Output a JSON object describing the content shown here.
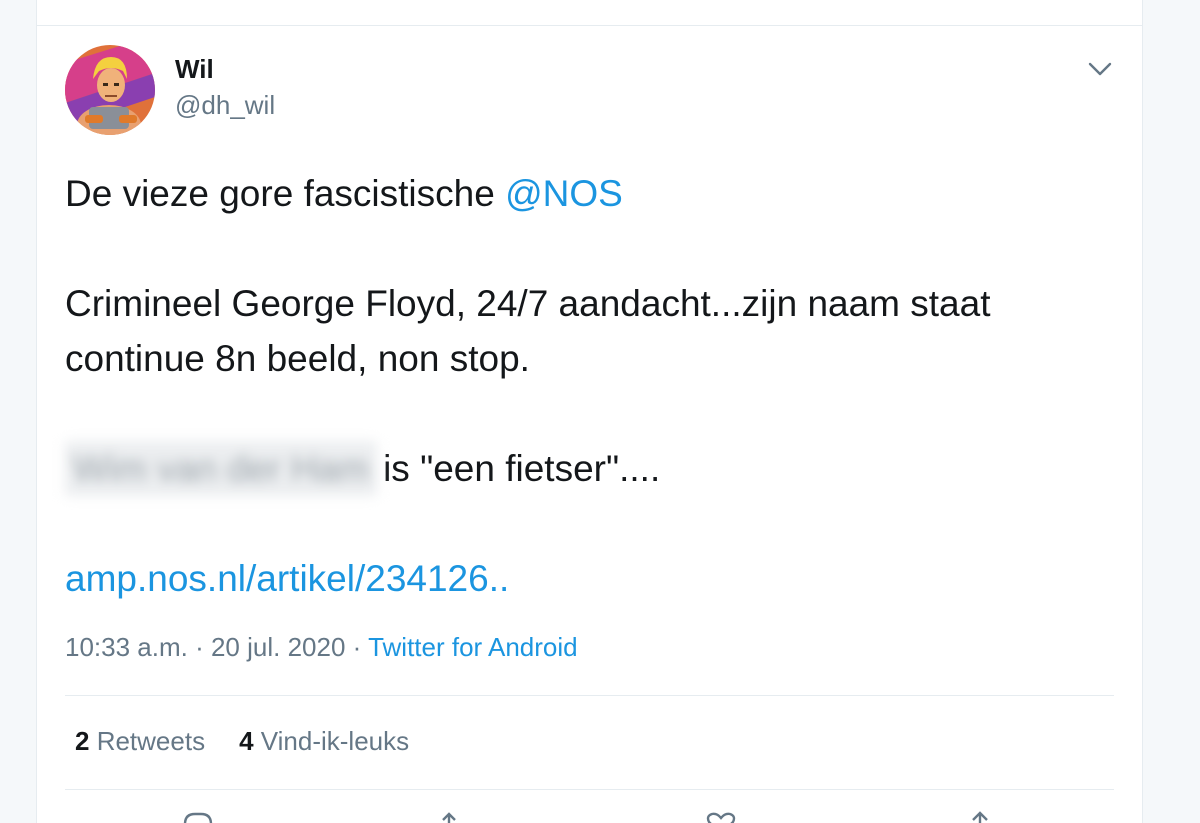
{
  "author": {
    "name": "Wil",
    "handle": "@dh_wil",
    "avatar_icon": "cartoon-hero-avatar"
  },
  "tweet": {
    "line1_text": "De vieze gore fascistische ",
    "line1_mention": "@NOS",
    "paragraph2": "Crimineel George Floyd, 24/7 aandacht...zijn naam staat continue 8n beeld, non stop.",
    "blurred_name": "Wim van der Ham",
    "paragraph3_text": "is \"een fietser\"....",
    "link": "amp.nos.nl/artikel/234126.."
  },
  "meta": {
    "time": "10:33 a.m.",
    "sep1": " · ",
    "date": "20 jul. 2020",
    "sep2": " · ",
    "source": "Twitter for Android"
  },
  "stats": {
    "retweets_count": "2",
    "retweets_label": " Retweets",
    "likes_count": "4",
    "likes_label": " Vind-ik-leuks"
  },
  "icons": {
    "menu": "chevron-down-icon",
    "reply": "reply-icon",
    "retweet": "retweet-icon",
    "like": "heart-icon",
    "share": "share-icon"
  },
  "colors": {
    "link": "#1b95e0",
    "text": "#14171a",
    "secondary": "#657786",
    "divider": "#e6ecf0"
  }
}
